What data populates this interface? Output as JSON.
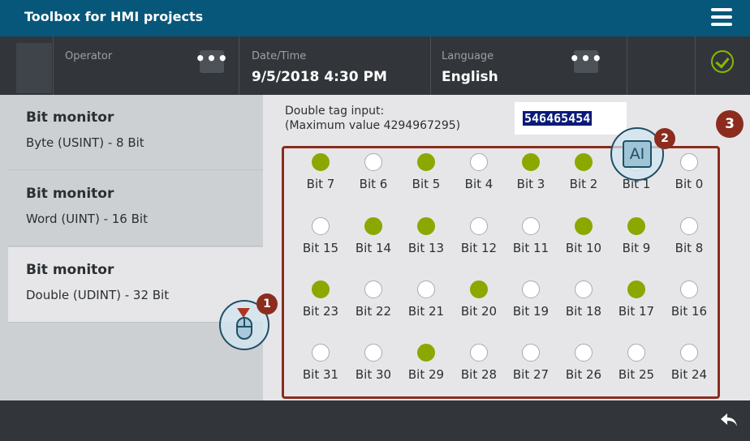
{
  "window": {
    "title": "Toolbox for HMI projects"
  },
  "header": {
    "operator_label": "Operator",
    "datetime_label": "Date/Time",
    "datetime_value": "9/5/2018 4:30 PM",
    "language_label": "Language",
    "language_value": "English",
    "dots": "•••"
  },
  "sidebar": {
    "items": [
      {
        "title": "Bit monitor",
        "subtitle": "Byte (USINT)  - 8 Bit"
      },
      {
        "title": "Bit monitor",
        "subtitle": "Word (UINT) - 16 Bit"
      },
      {
        "title": "Bit monitor",
        "subtitle": "Double (UDINT) - 32 Bit"
      }
    ],
    "active_index": 2
  },
  "input": {
    "label_line1": "Double tag input:",
    "label_line2": "(Maximum value 4294967295)",
    "value": "546465454"
  },
  "bits": [
    {
      "label": "Bit 7",
      "on": true
    },
    {
      "label": "Bit 6",
      "on": false
    },
    {
      "label": "Bit 5",
      "on": true
    },
    {
      "label": "Bit 4",
      "on": false
    },
    {
      "label": "Bit 3",
      "on": true
    },
    {
      "label": "Bit 2",
      "on": true
    },
    {
      "label": "Bit 1",
      "on": false
    },
    {
      "label": "Bit 0",
      "on": false
    },
    {
      "label": "Bit 15",
      "on": false
    },
    {
      "label": "Bit 14",
      "on": true
    },
    {
      "label": "Bit 13",
      "on": true
    },
    {
      "label": "Bit 12",
      "on": false
    },
    {
      "label": "Bit 11",
      "on": false
    },
    {
      "label": "Bit 10",
      "on": true
    },
    {
      "label": "Bit 9",
      "on": true
    },
    {
      "label": "Bit 8",
      "on": false
    },
    {
      "label": "Bit 23",
      "on": true
    },
    {
      "label": "Bit 22",
      "on": false
    },
    {
      "label": "Bit 21",
      "on": false
    },
    {
      "label": "Bit 20",
      "on": true
    },
    {
      "label": "Bit 19",
      "on": false
    },
    {
      "label": "Bit 18",
      "on": false
    },
    {
      "label": "Bit 17",
      "on": true
    },
    {
      "label": "Bit 16",
      "on": false
    },
    {
      "label": "Bit 31",
      "on": false
    },
    {
      "label": "Bit 30",
      "on": false
    },
    {
      "label": "Bit 29",
      "on": true
    },
    {
      "label": "Bit 28",
      "on": false
    },
    {
      "label": "Bit 27",
      "on": false
    },
    {
      "label": "Bit 26",
      "on": false
    },
    {
      "label": "Bit 25",
      "on": false
    },
    {
      "label": "Bit 24",
      "on": false
    }
  ],
  "annotations": {
    "badge1": "1",
    "badge2": "2",
    "badge3": "3",
    "keyboard_glyph": "AI"
  },
  "colors": {
    "title_bar": "#07577a",
    "led_on": "#8aa800",
    "frame": "#8b2c1f",
    "ok": "#8ab800"
  },
  "icons": [
    "hamburger-menu-icon",
    "more-dots-icon",
    "ok-check-icon",
    "back-arrow-icon",
    "mouse-click-icon",
    "keyboard-input-icon"
  ]
}
